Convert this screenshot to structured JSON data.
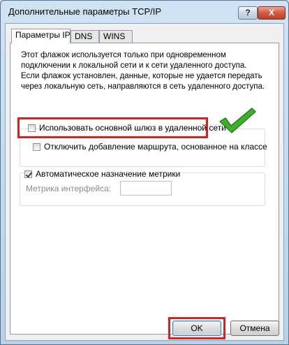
{
  "window": {
    "title": "Дополнительные параметры TCP/IP",
    "help_label": "?",
    "close_label": "X"
  },
  "tabs": [
    {
      "label": "Параметры IP",
      "active": true
    },
    {
      "label": "DNS",
      "active": false
    },
    {
      "label": "WINS",
      "active": false
    }
  ],
  "panel": {
    "description": "Этот флажок используется только при одновременном подключении к локальной сети и к сети удаленного доступа. Если флажок установлен, данные, которые не удается передать через локальную сеть, направляются в сеть удаленного доступа.",
    "use_gateway": {
      "label": "Использовать основной шлюз в удаленной сети",
      "checked": false
    },
    "disable_route": {
      "label": "Отключить добавление маршрута, основанное на классе",
      "checked": false
    },
    "auto_metric": {
      "label": "Автоматическое назначение метрики",
      "checked": true
    },
    "interface_metric": {
      "label": "Метрика интерфейса:",
      "value": ""
    }
  },
  "buttons": {
    "ok": "OK",
    "cancel": "Отмена"
  },
  "colors": {
    "highlight_box": "#d52222",
    "checkmark": "#3fae2a"
  },
  "annotation_icon": "green-checkmark-icon"
}
